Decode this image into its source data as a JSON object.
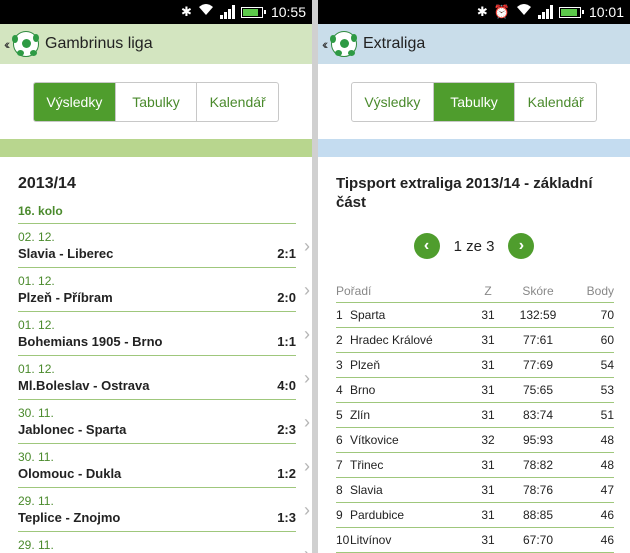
{
  "left": {
    "status": {
      "time": "10:55",
      "battery": 0.85
    },
    "appbar": {
      "back": "‹‹",
      "title": "Gambrinus liga"
    },
    "tabs": [
      {
        "label": "Výsledky",
        "active": true
      },
      {
        "label": "Tabulky",
        "active": false
      },
      {
        "label": "Kalendář",
        "active": false
      }
    ],
    "season": "2013/14",
    "round": "16. kolo",
    "matches": [
      {
        "date": "02. 12.",
        "teams": "Slavia - Liberec",
        "score": "2:1"
      },
      {
        "date": "01. 12.",
        "teams": "Plzeň - Příbram",
        "score": "2:0"
      },
      {
        "date": "01. 12.",
        "teams": "Bohemians 1905 - Brno",
        "score": "1:1"
      },
      {
        "date": "01. 12.",
        "teams": "Ml.Boleslav - Ostrava",
        "score": "4:0"
      },
      {
        "date": "30. 11.",
        "teams": "Jablonec - Sparta",
        "score": "2:3"
      },
      {
        "date": "30. 11.",
        "teams": "Olomouc - Dukla",
        "score": "1:2"
      },
      {
        "date": "29. 11.",
        "teams": "Teplice - Znojmo",
        "score": "1:3"
      },
      {
        "date": "29. 11.",
        "teams": "",
        "score": ""
      }
    ]
  },
  "right": {
    "status": {
      "time": "10:01",
      "battery": 0.9
    },
    "appbar": {
      "back": "‹‹",
      "title": "Extraliga"
    },
    "tabs": [
      {
        "label": "Výsledky",
        "active": false
      },
      {
        "label": "Tabulky",
        "active": true
      },
      {
        "label": "Kalendář",
        "active": false
      }
    ],
    "table_title": "Tipsport extraliga 2013/14 - základní část",
    "pager": {
      "prev": "‹",
      "text": "1 ze 3",
      "next": "›"
    },
    "columns": {
      "pos": "Pořadí",
      "z": "Z",
      "score": "Skóre",
      "points": "Body"
    },
    "rows": [
      {
        "pos": "1",
        "team": "Sparta",
        "z": "31",
        "score": "132:59",
        "points": "70"
      },
      {
        "pos": "2",
        "team": "Hradec Králové",
        "z": "31",
        "score": "77:61",
        "points": "60"
      },
      {
        "pos": "3",
        "team": "Plzeň",
        "z": "31",
        "score": "77:69",
        "points": "54"
      },
      {
        "pos": "4",
        "team": "Brno",
        "z": "31",
        "score": "75:65",
        "points": "53"
      },
      {
        "pos": "5",
        "team": "Zlín",
        "z": "31",
        "score": "83:74",
        "points": "51"
      },
      {
        "pos": "6",
        "team": "Vítkovice",
        "z": "32",
        "score": "95:93",
        "points": "48"
      },
      {
        "pos": "7",
        "team": "Třinec",
        "z": "31",
        "score": "78:82",
        "points": "48"
      },
      {
        "pos": "8",
        "team": "Slavia",
        "z": "31",
        "score": "78:76",
        "points": "47"
      },
      {
        "pos": "9",
        "team": "Pardubice",
        "z": "31",
        "score": "88:85",
        "points": "46"
      },
      {
        "pos": "10",
        "team": "Litvínov",
        "z": "31",
        "score": "67:70",
        "points": "46"
      }
    ]
  },
  "colors": {
    "accent_green": "#4f9d2d",
    "left_bar": "#d3e5c0",
    "right_bar": "#c9ddea"
  }
}
